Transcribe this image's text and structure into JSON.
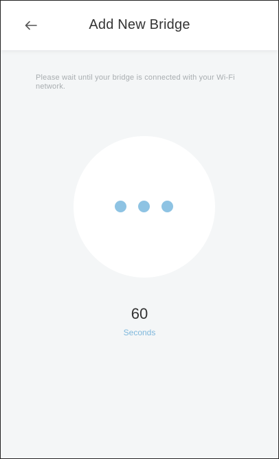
{
  "header": {
    "title": "Add New Bridge",
    "back_icon": "arrow-left-icon"
  },
  "message": "Please wait until your bridge is connected with your Wi-Fi network.",
  "loader": {
    "dot_icon": "loading-dot-icon",
    "dot_count": 3
  },
  "countdown": {
    "value": "60",
    "unit": "Seconds"
  },
  "colors": {
    "accent": "#7fb8dc",
    "dot": "#8ec3e3",
    "background": "#f4f6f7",
    "text": "#333333",
    "muted": "#a8adb0"
  }
}
